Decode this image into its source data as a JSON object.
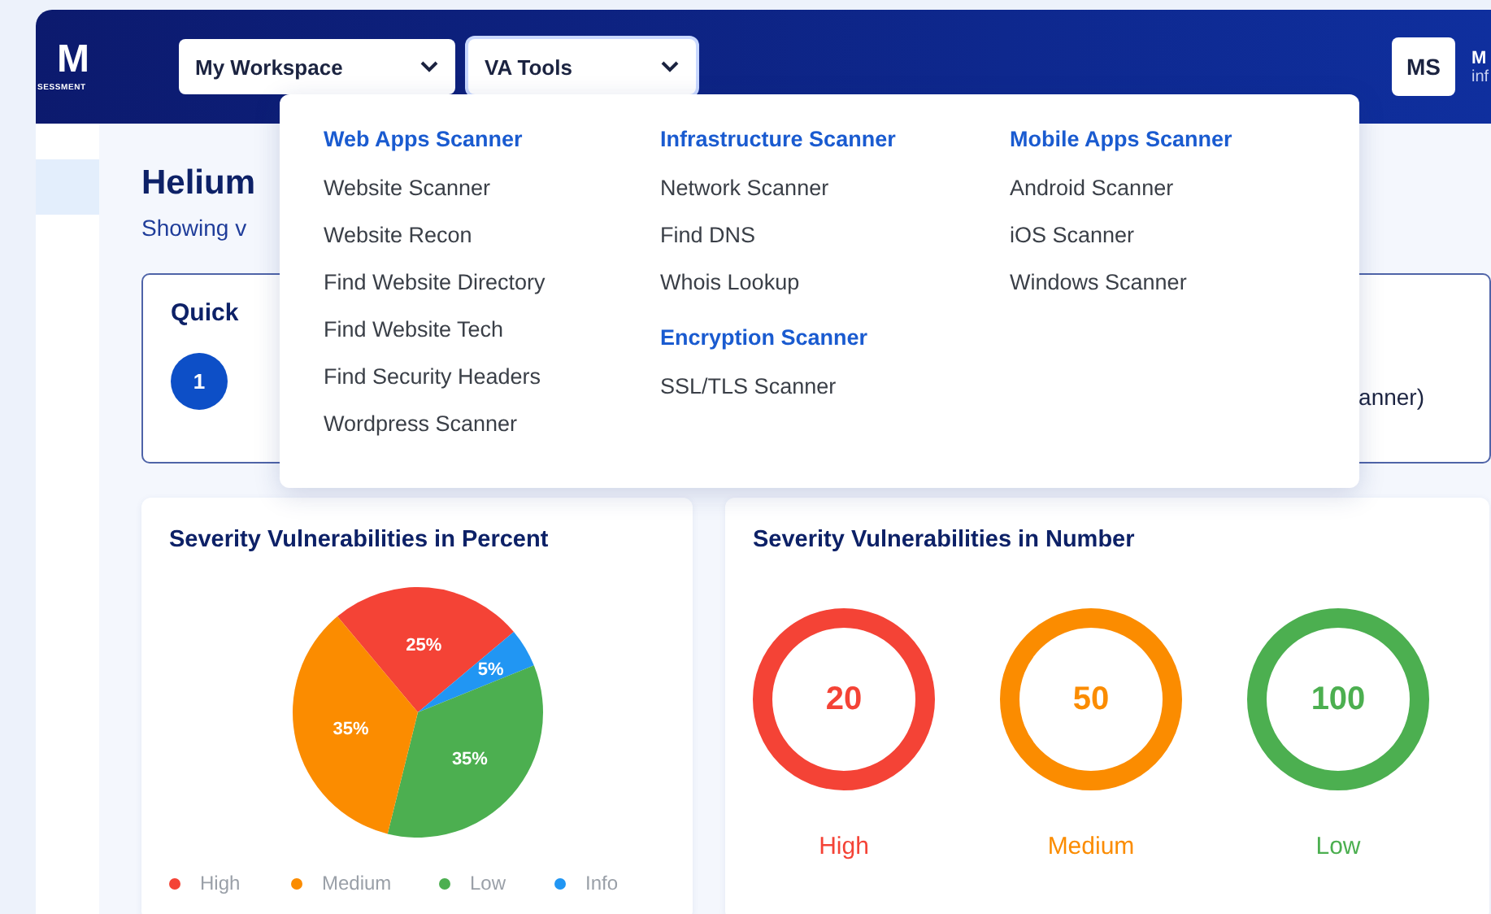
{
  "header": {
    "logo": "M",
    "logo_subtitle": "SESSMENT",
    "menus": [
      {
        "label": "My Workspace",
        "expanded": false
      },
      {
        "label": "VA Tools",
        "expanded": true
      }
    ],
    "avatar": "MS",
    "user_name": "M",
    "user_email": "inf"
  },
  "sidebar": {
    "items": [
      {
        "selected": true
      }
    ]
  },
  "page": {
    "title": "Helium",
    "subtitle": "Showing v"
  },
  "quick_card": {
    "title": "Quick",
    "step": "1",
    "tail": "anner)"
  },
  "tools_menu": {
    "columns": [
      [
        {
          "title": "Web Apps Scanner",
          "items": [
            "Website Scanner",
            "Website Recon",
            "Find Website Directory",
            "Find Website Tech",
            "Find Security Headers",
            "Wordpress Scanner"
          ]
        }
      ],
      [
        {
          "title": "Infrastructure Scanner",
          "items": [
            "Network Scanner",
            "Find DNS",
            "Whois Lookup"
          ]
        },
        {
          "title": "Encryption Scanner",
          "items": [
            "SSL/TLS Scanner"
          ]
        }
      ],
      [
        {
          "title": "Mobile Apps Scanner",
          "items": [
            "Android Scanner",
            "iOS Scanner",
            "Windows Scanner"
          ]
        }
      ]
    ]
  },
  "percent_card": {
    "title": "Severity Vulnerabilities in Percent",
    "chart_data": {
      "type": "pie",
      "categories": [
        "High",
        "Medium",
        "Low",
        "Info"
      ],
      "values": [
        25,
        35,
        35,
        5
      ],
      "colors": [
        "#f44336",
        "#fb8c00",
        "#4caf50",
        "#2196f3"
      ],
      "value_labels": [
        "25%",
        "35%",
        "35%",
        "5%"
      ]
    }
  },
  "number_card": {
    "title": "Severity Vulnerabilities in Number",
    "rings": [
      {
        "value": "20",
        "label": "High",
        "color": "#f44336"
      },
      {
        "value": "50",
        "label": "Medium",
        "color": "#fb8c00"
      },
      {
        "value": "100",
        "label": "Low",
        "color": "#4caf50"
      }
    ]
  }
}
